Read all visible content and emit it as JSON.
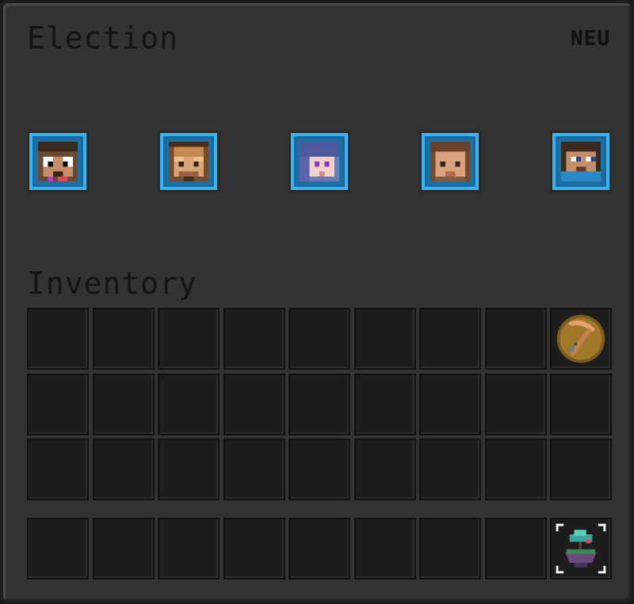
{
  "window": {
    "title": "Election",
    "tag": "NEU"
  },
  "candidates": [
    {
      "icon": "candidate-head-glasses-icon"
    },
    {
      "icon": "candidate-head-goggles-icon"
    },
    {
      "icon": "candidate-head-blue-hair-icon"
    },
    {
      "icon": "candidate-head-brown-hair-icon"
    },
    {
      "icon": "candidate-head-blue-shirt-icon"
    }
  ],
  "inventory": {
    "title": "Inventory",
    "rows": 3,
    "columns": 9,
    "items": [
      {
        "icon": "pickaxe-badge-icon",
        "row": 1,
        "column": 9
      }
    ],
    "hotbar_items": [
      {
        "icon": "floating-island-icon",
        "column": 9
      }
    ]
  },
  "colors": {
    "panel": "#333333",
    "slot": "#1d1d1d",
    "candidate_frame": "#39b4f0"
  }
}
